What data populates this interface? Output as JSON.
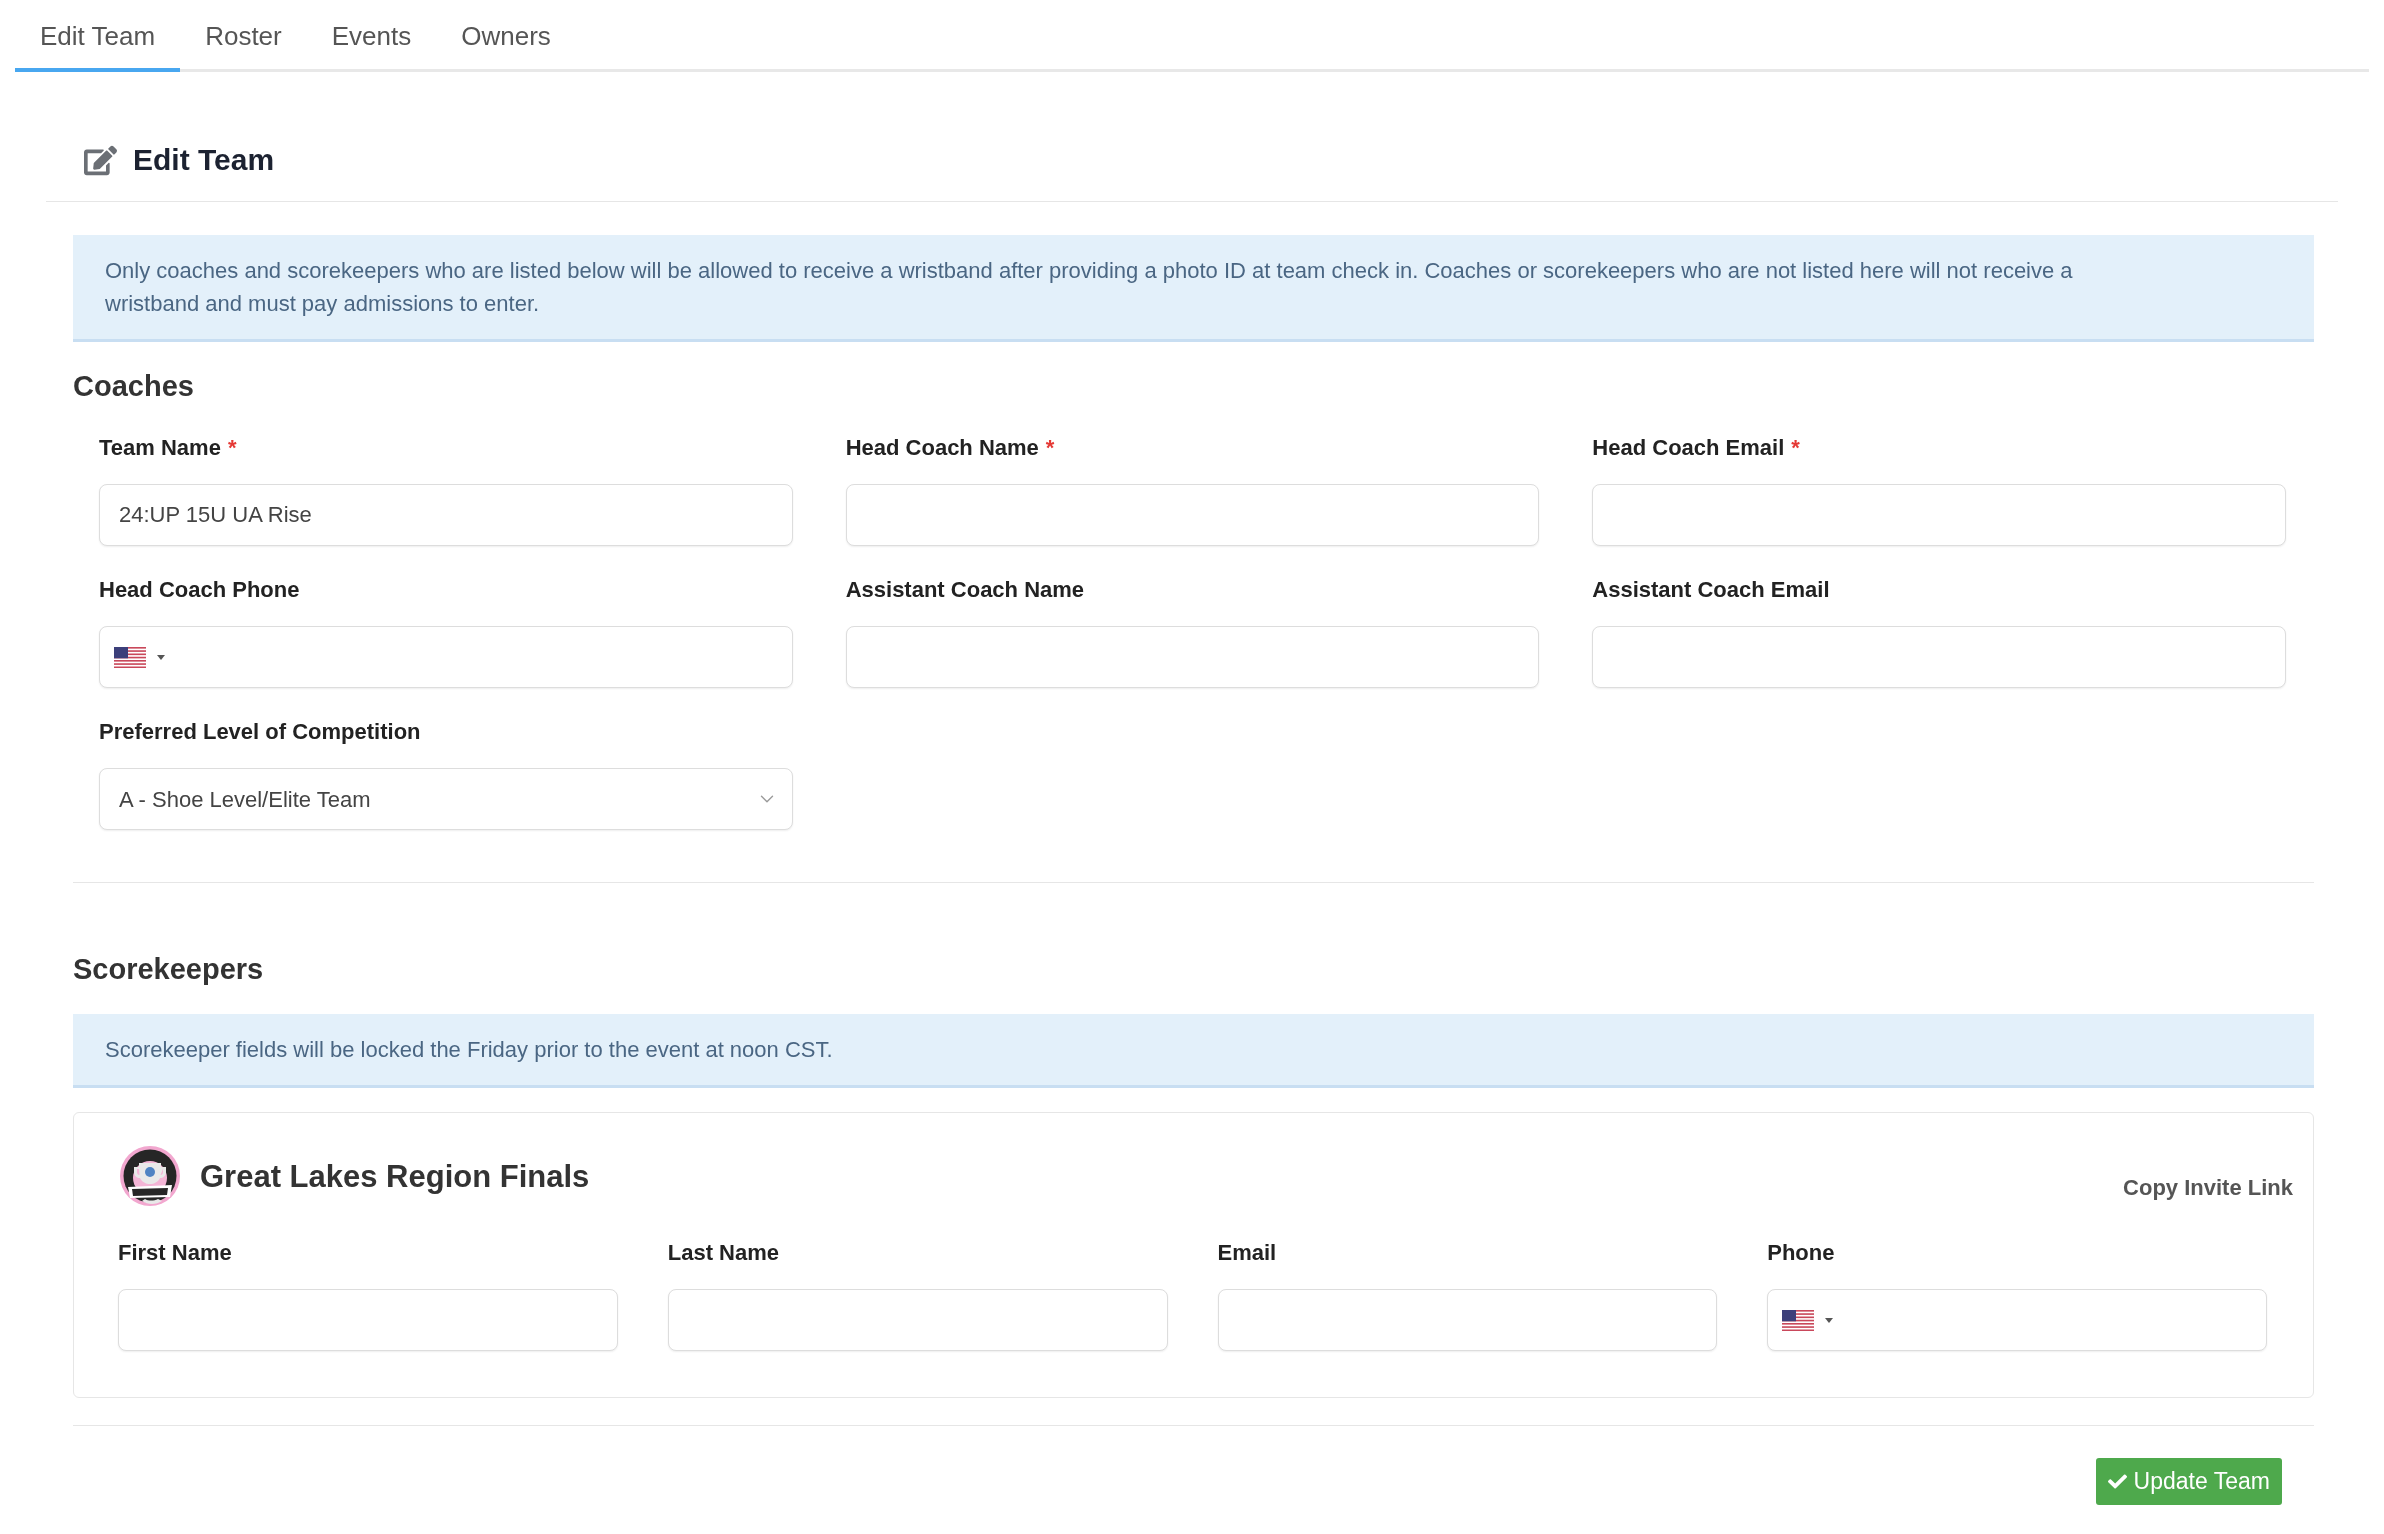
{
  "tabs": [
    {
      "label": "Edit Team",
      "selected": true
    },
    {
      "label": "Roster",
      "selected": false
    },
    {
      "label": "Events",
      "selected": false
    },
    {
      "label": "Owners",
      "selected": false
    }
  ],
  "panel": {
    "title": "Edit Team"
  },
  "coaches": {
    "notice": "Only coaches and scorekeepers who are listed below will be allowed to receive a wristband after providing a photo ID at team check in. Coaches or scorekeepers who are not listed here will not receive a wristband and must pay admissions to enter.",
    "heading": "Coaches",
    "fields": [
      {
        "label": "Team Name",
        "required_mark": "*",
        "kind": "text",
        "value": "24:UP 15U UA Rise"
      },
      {
        "label": "Head Coach Name",
        "required_mark": "*",
        "kind": "text"
      },
      {
        "label": "Head Coach Email",
        "required_mark": "*",
        "kind": "text"
      },
      {
        "label": "Head Coach Phone",
        "kind": "phone"
      },
      {
        "label": "Assistant Coach Name",
        "kind": "text"
      },
      {
        "label": "Assistant Coach Email",
        "kind": "text"
      },
      {
        "label": "Preferred Level of Competition",
        "kind": "select",
        "value": "A - Shoe Level/Elite Team"
      }
    ]
  },
  "scorekeepers": {
    "heading": "Scorekeepers",
    "notice": "Scorekeeper fields will be locked the Friday prior to the event at noon CST.",
    "events": [
      {
        "title": "Great Lakes Region Finals",
        "action": "Copy Invite Link",
        "fields": [
          {
            "label": "First Name",
            "kind": "text"
          },
          {
            "label": "Last Name",
            "kind": "text"
          },
          {
            "label": "Email",
            "kind": "text"
          },
          {
            "label": "Phone",
            "kind": "phone"
          }
        ]
      }
    ]
  },
  "submit": {
    "label": "Update Team"
  }
}
